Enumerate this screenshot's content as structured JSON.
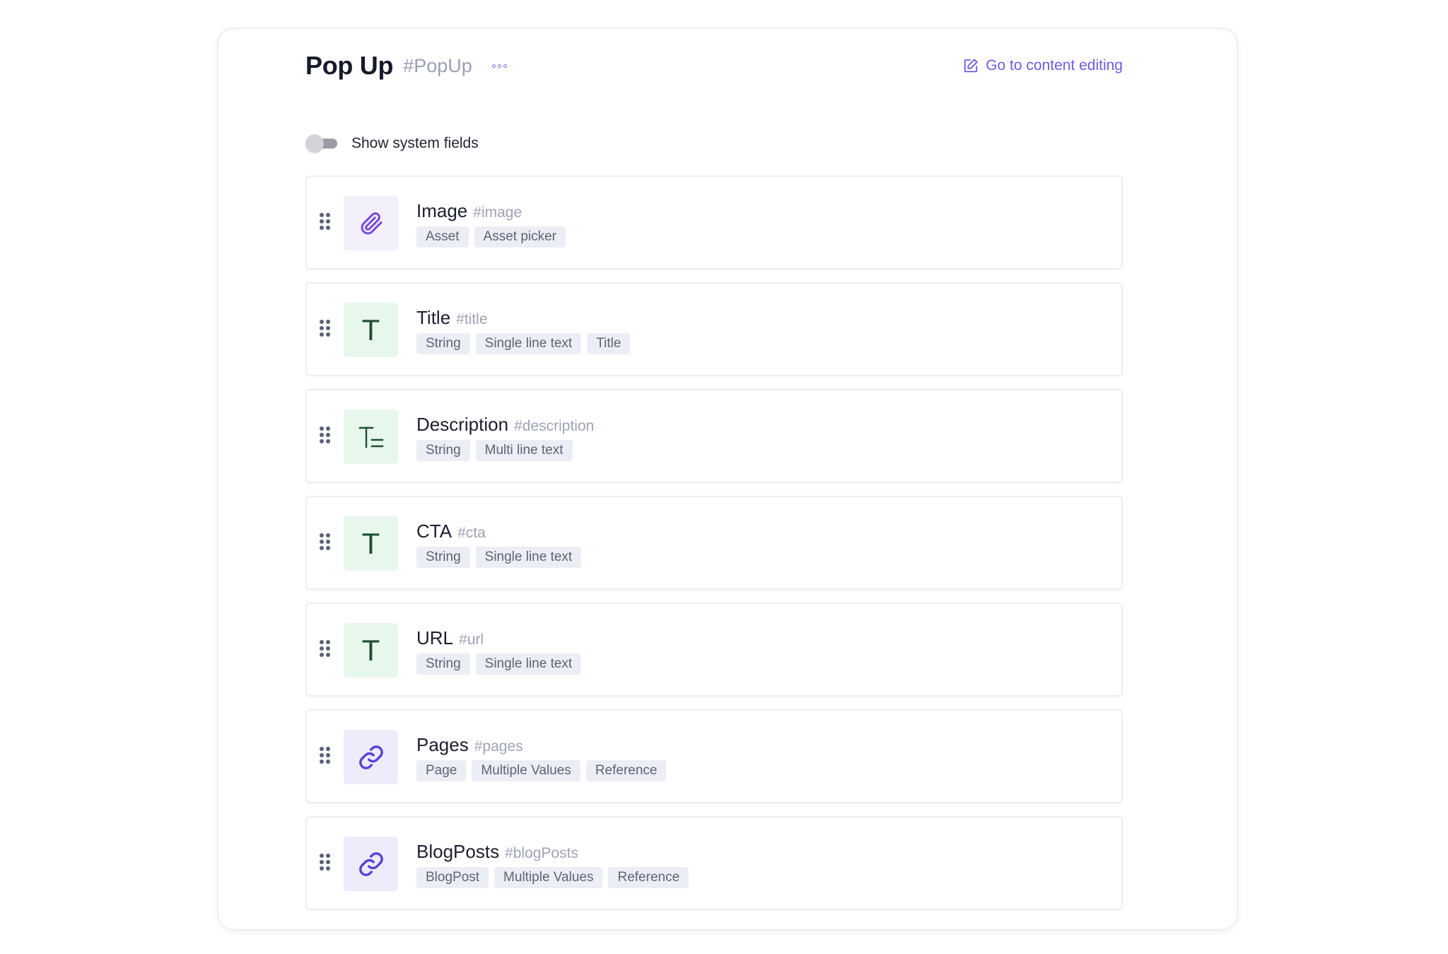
{
  "header": {
    "model_name": "Pop Up",
    "model_api_id": "#PopUp",
    "more_icon": "more-horizontal-icon",
    "edit_link_label": "Go to content editing",
    "edit_link_icon": "edit-icon"
  },
  "toggle": {
    "label": "Show system fields",
    "checked": false
  },
  "fields": [
    {
      "name": "Image",
      "api_id": "#image",
      "icon": "paperclip-icon",
      "tags": [
        "Asset",
        "Asset picker"
      ]
    },
    {
      "name": "Title",
      "api_id": "#title",
      "icon": "single-line-text-icon",
      "tags": [
        "String",
        "Single line text",
        "Title"
      ]
    },
    {
      "name": "Description",
      "api_id": "#description",
      "icon": "multi-line-text-icon",
      "tags": [
        "String",
        "Multi line text"
      ]
    },
    {
      "name": "CTA",
      "api_id": "#cta",
      "icon": "single-line-text-icon",
      "tags": [
        "String",
        "Single line text"
      ]
    },
    {
      "name": "URL",
      "api_id": "#url",
      "icon": "single-line-text-icon",
      "tags": [
        "String",
        "Single line text"
      ]
    },
    {
      "name": "Pages",
      "api_id": "#pages",
      "icon": "link-icon",
      "tags": [
        "Page",
        "Multiple Values",
        "Reference"
      ]
    },
    {
      "name": "BlogPosts",
      "api_id": "#blogPosts",
      "icon": "link-icon",
      "tags": [
        "BlogPost",
        "Multiple Values",
        "Reference"
      ]
    }
  ],
  "colors": {
    "accent": "#6b5ce7",
    "text_icon_green": "#1f4e33",
    "tag_bg": "#eceef5"
  }
}
